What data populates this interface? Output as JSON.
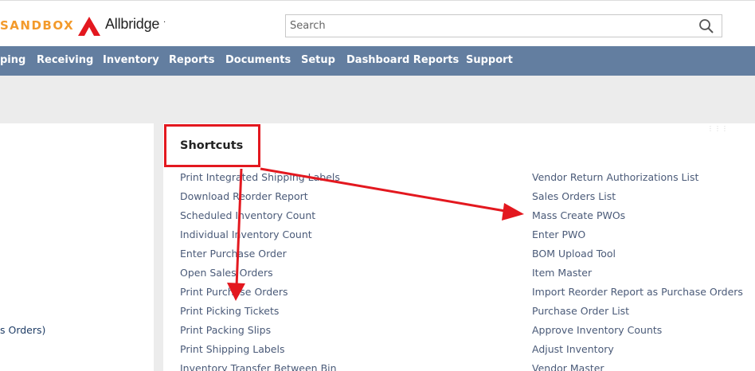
{
  "header": {
    "sandbox_label": "SANDBOX",
    "brand_name": "Allbridge",
    "brand_trailing": ".",
    "search_placeholder": "Search",
    "search_icon": "search-icon",
    "logo_color": "#e3181f",
    "sandbox_color": "#f39a2b"
  },
  "nav": {
    "bar_color": "#637ea0",
    "items": [
      "ping",
      "Receiving",
      "Inventory",
      "Reports",
      "Documents",
      "Setup",
      "Dashboard Reports",
      "Support"
    ]
  },
  "left_panel": {
    "partial_text": "s Orders)"
  },
  "shortcuts": {
    "title": "Shortcuts",
    "column_left": [
      "Print Integrated Shipping Labels",
      "Download Reorder Report",
      "Scheduled Inventory Count",
      "Individual Inventory Count",
      "Enter Purchase Order",
      "Open Sales Orders",
      "Print Purchase Orders",
      "Print Picking Tickets",
      "Print Packing Slips",
      "Print Shipping Labels",
      "Inventory Transfer Between Bin"
    ],
    "column_right": [
      "Vendor Return Authorizations List",
      "Sales Orders List",
      "Mass Create PWOs",
      "Enter PWO",
      "BOM Upload Tool",
      "Item Master",
      "Import Reorder Report as Purchase Orders",
      "Purchase Order List",
      "Approve Inventory Counts",
      "Adjust Inventory",
      "Vendor Master"
    ]
  },
  "annotation": {
    "color": "#e3181f"
  }
}
